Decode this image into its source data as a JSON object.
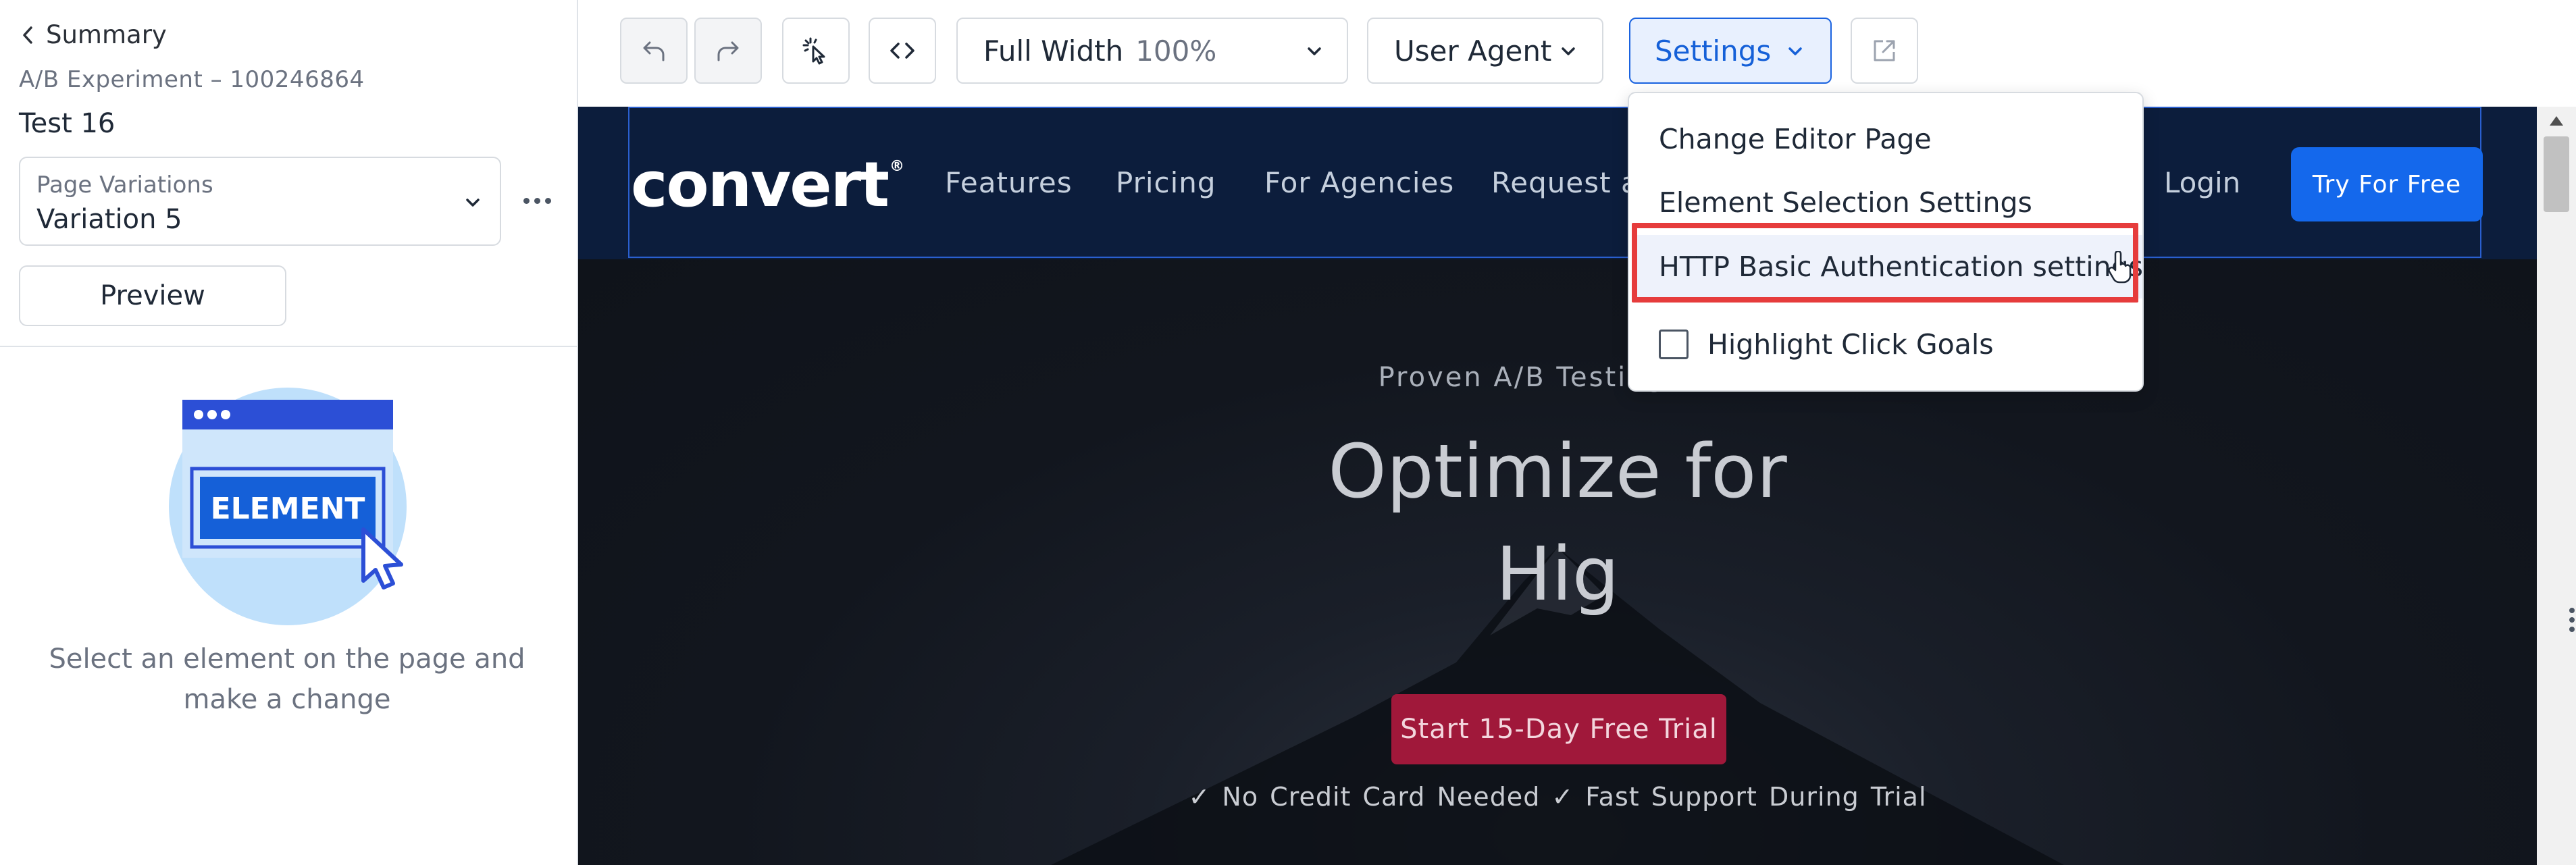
{
  "sidebar": {
    "back_label": "Summary",
    "experiment_label": "A/B Experiment – 100246864",
    "test_name": "Test 16",
    "variation_select": {
      "label": "Page Variations",
      "value": "Variation 5"
    },
    "preview_label": "Preview",
    "illustration_text": "ELEMENT",
    "help_text": "Select an element on the page and make a change"
  },
  "toolbar": {
    "width_label": "Full Width",
    "width_percent": "100%",
    "user_agent_label": "User Agent",
    "settings_label": "Settings",
    "icons": [
      "undo-icon",
      "redo-icon",
      "select-element-icon",
      "code-icon",
      "external-link-icon"
    ]
  },
  "settings_menu": {
    "items": [
      "Change Editor Page",
      "Element Selection Settings",
      "HTTP Basic Authentication settings"
    ],
    "highlighted_index": 2,
    "checkbox_label": "Highlight Click Goals",
    "checkbox_checked": false
  },
  "site": {
    "logo": "convert",
    "nav_links": [
      "Features",
      "Pricing",
      "For Agencies",
      "Request a"
    ],
    "login_label": "Login",
    "cta_label": "Try For Free",
    "hero_eyebrow": "Proven A/B Testing Tool",
    "hero_title_line1": "Optimize for",
    "hero_title_line2": "Hig",
    "hero_cta": "Start 15-Day Free Trial",
    "hero_checks": "✓ No Credit Card Needed   ✓ Fast Support During Trial"
  },
  "colors": {
    "accent": "#1a63e0",
    "nav_background": "#0c1d3c",
    "cta_blue": "#1468ec",
    "hero_cta": "#a0183a",
    "highlight_frame": "#e63c3c"
  }
}
